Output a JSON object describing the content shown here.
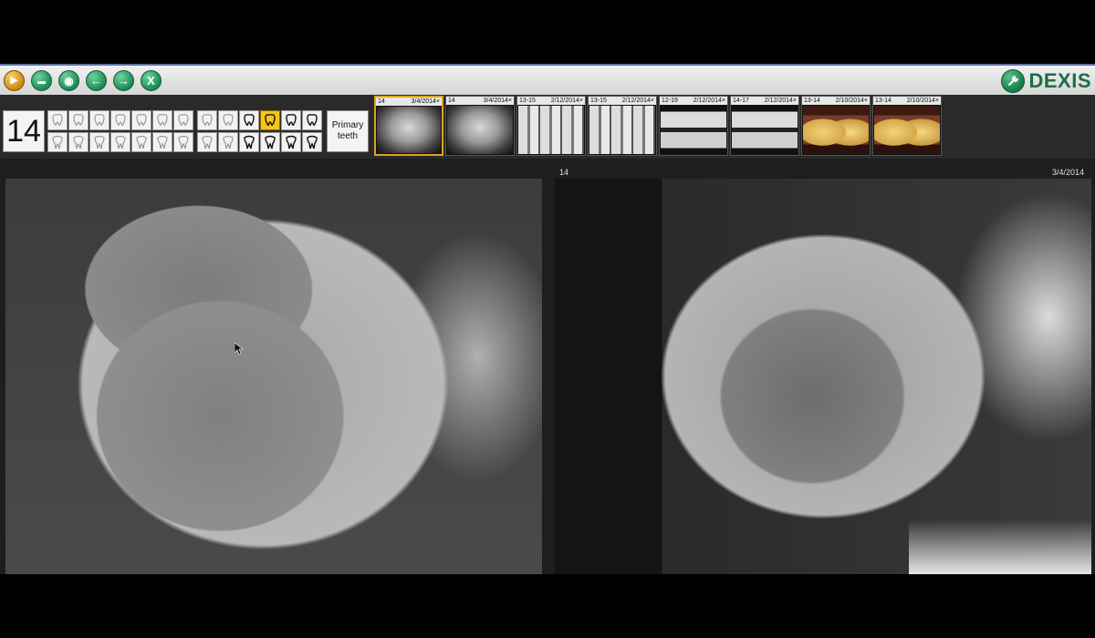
{
  "toolbar": {
    "buttons": [
      {
        "name": "play-icon",
        "glyph": "▶"
      },
      {
        "name": "open-folder-icon",
        "glyph": "▬"
      },
      {
        "name": "view-eye-icon",
        "glyph": "◉"
      },
      {
        "name": "back-arrow-icon",
        "glyph": "←"
      },
      {
        "name": "forward-arrow-icon",
        "glyph": "→"
      },
      {
        "name": "close-x-icon",
        "glyph": "X"
      }
    ],
    "brand": "DEXIS",
    "brand_icon": "wrench-icon"
  },
  "tooth_selector": {
    "current_tooth": "14",
    "selected_tooth_icon": "molar-highlight",
    "primary_label_line1": "Primary",
    "primary_label_line2": "teeth"
  },
  "thumbnails": [
    {
      "teeth": "14",
      "date": "3/4/2014",
      "kind": "xray"
    },
    {
      "teeth": "14",
      "date": "3/4/2014",
      "kind": "xray"
    },
    {
      "teeth": "13-15",
      "date": "2/12/2014",
      "kind": "bw"
    },
    {
      "teeth": "13-15",
      "date": "2/12/2014",
      "kind": "bw"
    },
    {
      "teeth": "12-19",
      "date": "2/12/2014",
      "kind": "bite"
    },
    {
      "teeth": "14-17",
      "date": "2/12/2014",
      "kind": "bite"
    },
    {
      "teeth": "13-14",
      "date": "2/10/2014",
      "kind": "photo"
    },
    {
      "teeth": "13-14",
      "date": "2/10/2014",
      "kind": "photo"
    }
  ],
  "thumb_close": "×",
  "viewer": {
    "title": "14",
    "date": "3/4/2014"
  },
  "colors": {
    "accent_green": "#1e6e45",
    "selection_gold": "#f5c518"
  }
}
